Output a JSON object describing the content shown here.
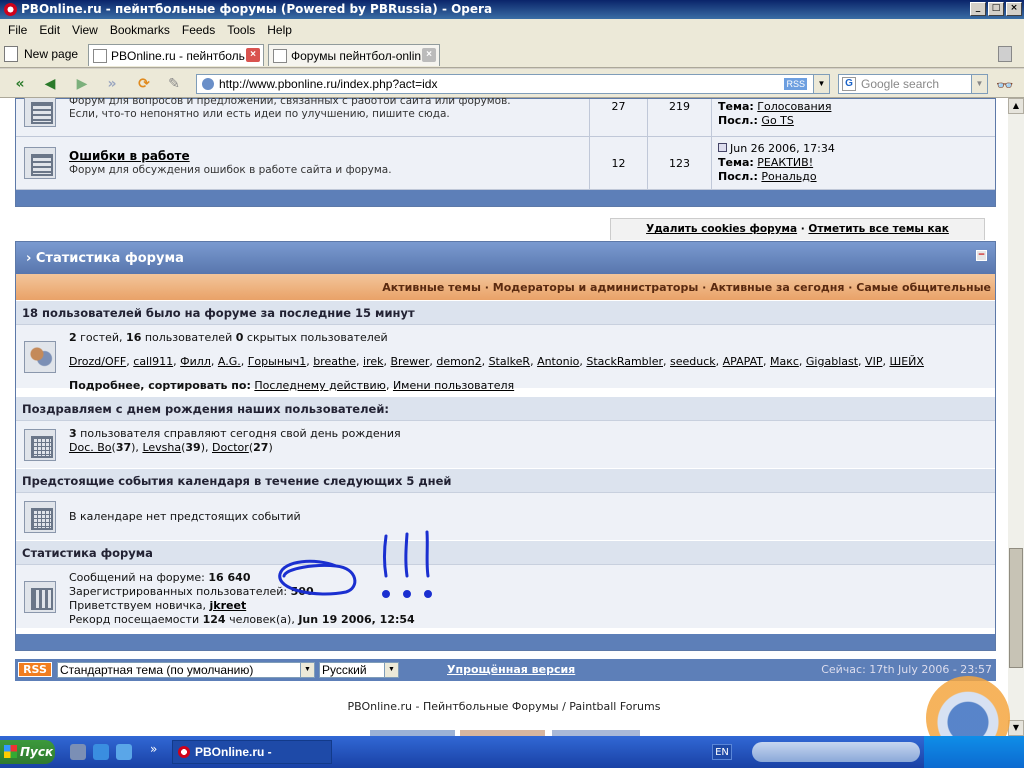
{
  "window": {
    "title": "PBOnline.ru - пейнтбольные форумы (Powered by PBRussia) - Opera"
  },
  "menu": [
    "File",
    "Edit",
    "View",
    "Bookmarks",
    "Feeds",
    "Tools",
    "Help"
  ],
  "tabs": {
    "new_page": "New page",
    "items": [
      {
        "label": "PBOnline.ru - пейнтболь...",
        "active": true
      },
      {
        "label": "Форумы пейнтбол-onlin...",
        "active": false
      }
    ]
  },
  "address": {
    "url": "http://www.pbonline.ru/index.php?act=idx",
    "rss": "RSS",
    "search_placeholder": "Google search"
  },
  "forums": [
    {
      "name": "",
      "desc_line1": "Форум для вопросов и предложений, связанных с работой сайта или форумов.",
      "desc_line2": "Если, что-то непонятно или есть идеи по улучшению, пишите сюда.",
      "topics": "27",
      "posts": "219",
      "last_date": "",
      "topic_label": "Тема:",
      "topic": "Голосования",
      "by_label": "Посл.:",
      "by": "Go TS"
    },
    {
      "name": "Ошибки в работе",
      "desc_line1": "Форум для обсуждения ошибок в работе сайта и форума.",
      "topics": "12",
      "posts": "123",
      "last_date": "Jun 26 2006, 17:34",
      "topic_label": "Тема:",
      "topic": "РЕАКТИВ!",
      "by_label": "Посл.:",
      "by": "Рональдо"
    }
  ],
  "cookies": {
    "delete": "Удалить cookies форума",
    "sep": "·",
    "mark_read": "Отметить все темы как прочитанные"
  },
  "stats": {
    "title": "Статистика форума",
    "links": "Активные темы · Модераторы и администраторы · Активные за сегодня · Самые общительные",
    "online": {
      "title": "18 пользователей было на форуме за последние 15 минут",
      "guests": "2",
      "guests_label": "гостей,",
      "users": "16",
      "users_label": "пользователей",
      "hidden": "0",
      "hidden_label": "скрытых пользователей",
      "names": [
        "Drozd/OFF",
        "call911",
        "Филл",
        "A.G.",
        "Горыныч1",
        "breathe",
        "irek",
        "Brewer",
        "demon2",
        "StalkeR",
        "Antonio",
        "StackRambler",
        "seeduck",
        "APAPAT",
        "Макс",
        "Gigablast",
        "VIP",
        "ШЕЙХ"
      ],
      "sort_label": "Подробнее, сортировать по:",
      "sort_last": "Последнему действию",
      "sort_name": "Имени пользователя"
    },
    "birthdays": {
      "title": "Поздравляем с днем рождения наших пользователей:",
      "count": "3",
      "count_label": "пользователя справляют сегодня свой день рождения",
      "people": [
        {
          "name": "Doc. Bo",
          "age": "37"
        },
        {
          "name": "Levsha",
          "age": "39"
        },
        {
          "name": "Doctor",
          "age": "27"
        }
      ]
    },
    "calendar": {
      "title": "Предстоящие события календаря в течение следующих 5 дней",
      "empty": "В календаре нет предстоящих событий"
    },
    "forum_stats": {
      "title": "Статистика форума",
      "posts_label": "Сообщений на форуме:",
      "posts": "16 640",
      "users_label": "Зарегистрированных пользователей:",
      "users": "500",
      "newbie_label": "Приветствуем новичка,",
      "newbie": "jkreet",
      "record_label": "Рекорд посещаемости",
      "record_count": "124",
      "record_mid": "человек(а),",
      "record_date": "Jun 19 2006, 12:54"
    }
  },
  "footer": {
    "rss": "RSS",
    "theme": "Стандартная тема (по умолчанию)",
    "language": "Русский",
    "lite": "Упрощённая версия",
    "now": "Сейчас: 17th July 2006 - 23:57",
    "copyright": "PBOnline.ru - Пейнтбольные Форумы / Paintball Forums"
  },
  "taskbar": {
    "start": "Пуск",
    "item": "PBOnline.ru - пейнтбо...",
    "lang": "EN"
  },
  "colors": {
    "forum_blue": "#5d7fb8",
    "orange_bar": "#e9a268",
    "scribble": "#1a2fd0"
  }
}
